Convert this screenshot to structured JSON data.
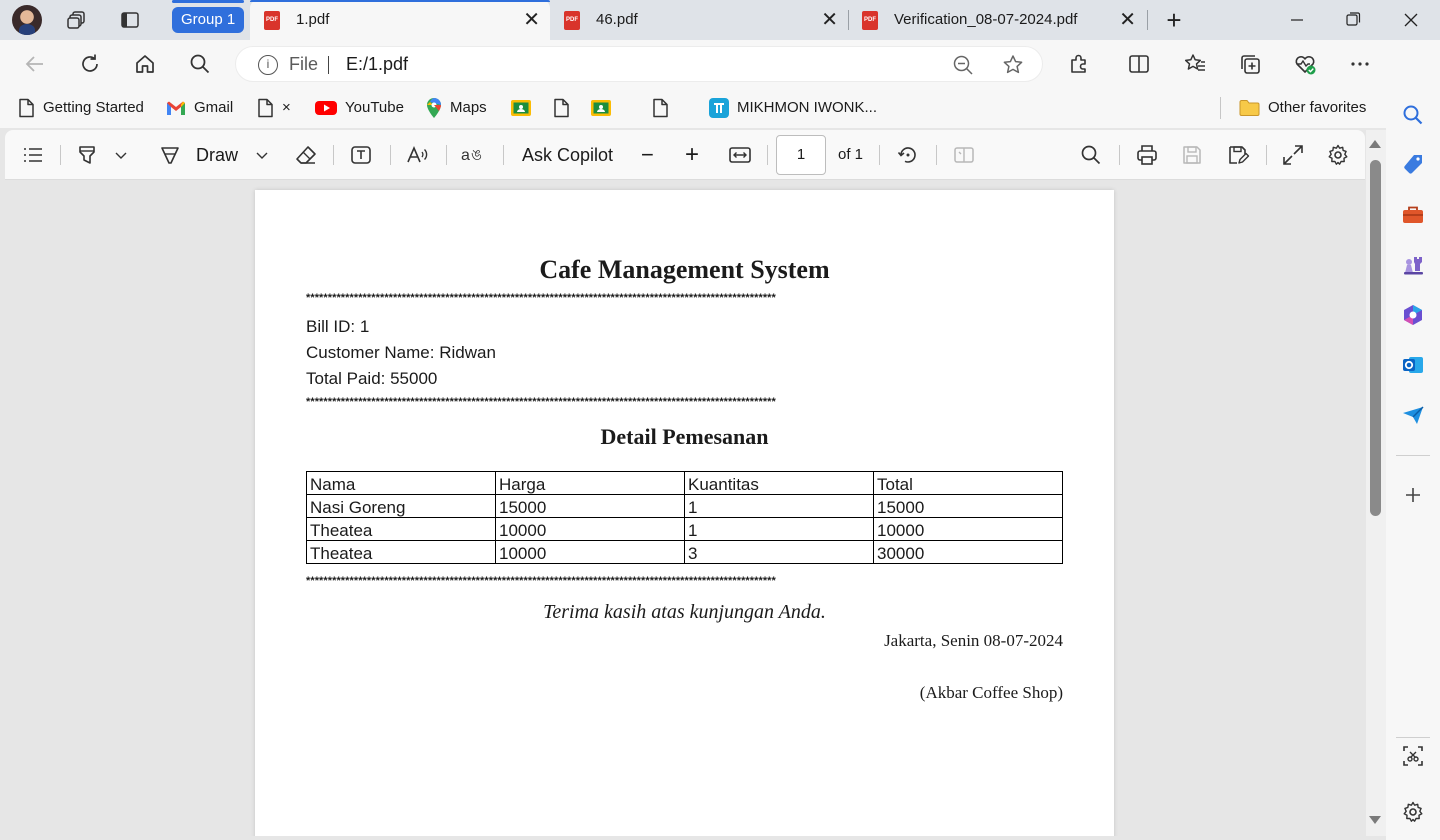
{
  "tabs": {
    "group_label": "Group 1",
    "items": [
      {
        "title": "1.pdf",
        "close": "✕"
      },
      {
        "title": "46.pdf",
        "close": "✕"
      },
      {
        "title": "Verification_08-07-2024.pdf",
        "close": "✕"
      }
    ],
    "new_tab": "+",
    "pdf_badge": "PDF"
  },
  "address": {
    "info_glyph": "i",
    "scheme_label": "File",
    "url": "E:/1.pdf"
  },
  "favorites": {
    "items": [
      {
        "label": "Getting Started",
        "icon": "page-icon"
      },
      {
        "label": "Gmail",
        "icon": "gmail-icon"
      },
      {
        "label": "×",
        "icon": "page-icon"
      },
      {
        "label": "YouTube",
        "icon": "youtube-icon"
      },
      {
        "label": "Maps",
        "icon": "maps-icon"
      },
      {
        "label": "MIKHMON IWONK...",
        "icon": "mikhmon-icon"
      }
    ],
    "other": "Other favorites"
  },
  "pdf_toolbar": {
    "draw_label": "Draw",
    "ask_copilot": "Ask Copilot",
    "zoom_out": "−",
    "zoom_in": "+",
    "page_number": "1",
    "page_total": "of 1"
  },
  "document": {
    "title": "Cafe Management System",
    "separator": "************************************************************************************************************",
    "bill_id": "Bill ID: 1",
    "customer": "Customer Name: Ridwan",
    "total_paid": "Total Paid: 55000",
    "detail_title": "Detail Pemesanan",
    "table": {
      "headers": [
        "Nama",
        "Harga",
        "Kuantitas",
        "Total"
      ],
      "rows": [
        [
          "Nasi Goreng",
          "15000",
          "1",
          "15000"
        ],
        [
          "Theatea",
          "10000",
          "1",
          "10000"
        ],
        [
          "Theatea",
          "10000",
          "3",
          "30000"
        ]
      ]
    },
    "thanks": "Terima kasih atas kunjungan Anda.",
    "place_date": "Jakarta, Senin 08-07-2024",
    "shop": "(Akbar Coffee Shop)"
  },
  "colors": {
    "accent": "#2f6fdc",
    "pdf_red": "#d9342b"
  }
}
